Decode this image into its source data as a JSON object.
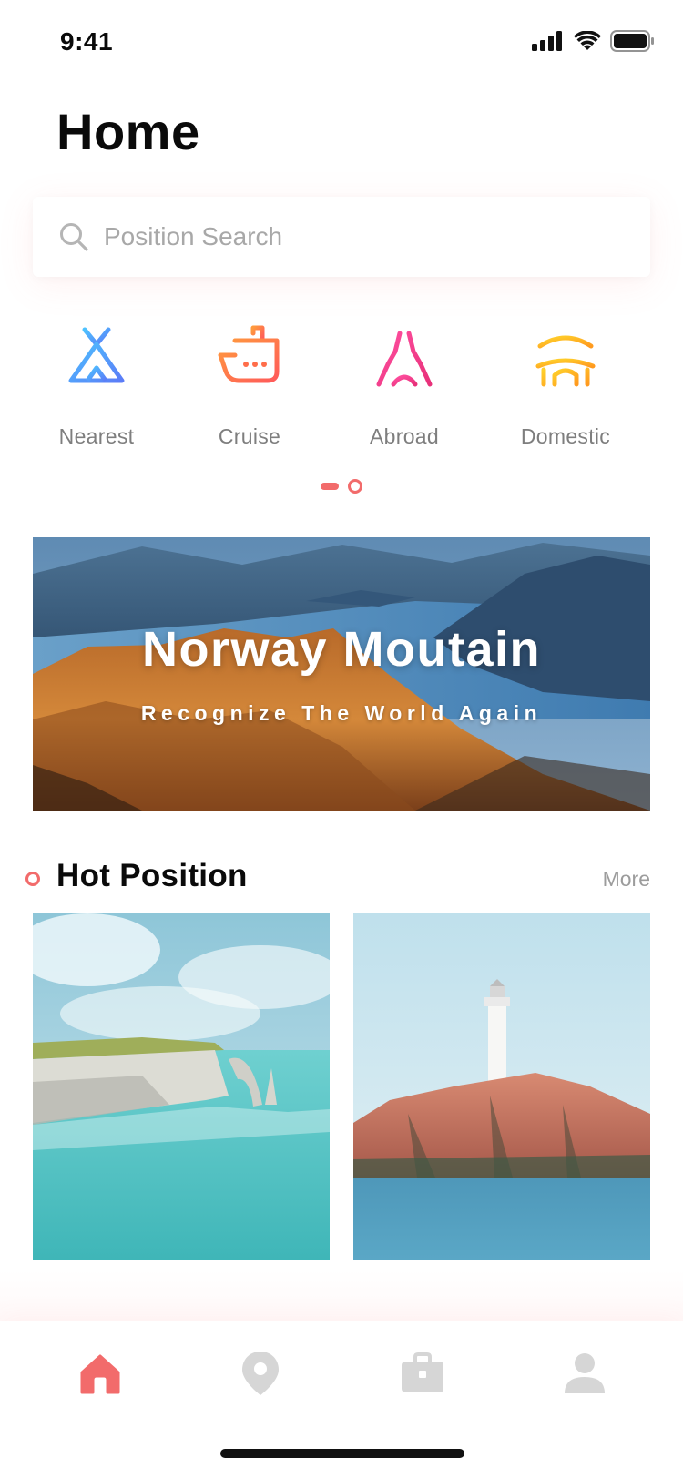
{
  "status_bar": {
    "time": "9:41",
    "icons": [
      "signal-icon",
      "wifi-icon",
      "battery-icon"
    ]
  },
  "page": {
    "title": "Home"
  },
  "search": {
    "placeholder": "Position Search",
    "value": "",
    "icon": "search-icon"
  },
  "categories": [
    {
      "label": "Nearest",
      "icon": "tent-icon",
      "color": "#5aa2f7"
    },
    {
      "label": "Cruise",
      "icon": "ship-icon",
      "color": "#ff7a4d"
    },
    {
      "label": "Abroad",
      "icon": "tower-icon",
      "color": "#f2478b"
    },
    {
      "label": "Domestic",
      "icon": "pavilion-icon",
      "color": "#ffb020"
    }
  ],
  "pager": {
    "active_index": 0,
    "count": 2
  },
  "banner": {
    "title": "Norway Moutain",
    "subtitle": "Recognize The World Again"
  },
  "hot_section": {
    "title": "Hot Position",
    "more_label": "More",
    "cards": [
      {
        "image": "sea-cliff-arch-photo"
      },
      {
        "image": "lighthouse-rock-photo"
      }
    ]
  },
  "tab_bar": {
    "items": [
      {
        "icon": "home-icon",
        "active": true
      },
      {
        "icon": "location-pin-icon",
        "active": false
      },
      {
        "icon": "briefcase-icon",
        "active": false
      },
      {
        "icon": "user-icon",
        "active": false
      }
    ],
    "active_color": "#f26b6b",
    "inactive_color": "#d6d6d6"
  },
  "colors": {
    "accent": "#f26b6b",
    "text_primary": "#0a0a0a",
    "text_secondary": "#7e7e7e",
    "placeholder": "#a8a8a8"
  }
}
